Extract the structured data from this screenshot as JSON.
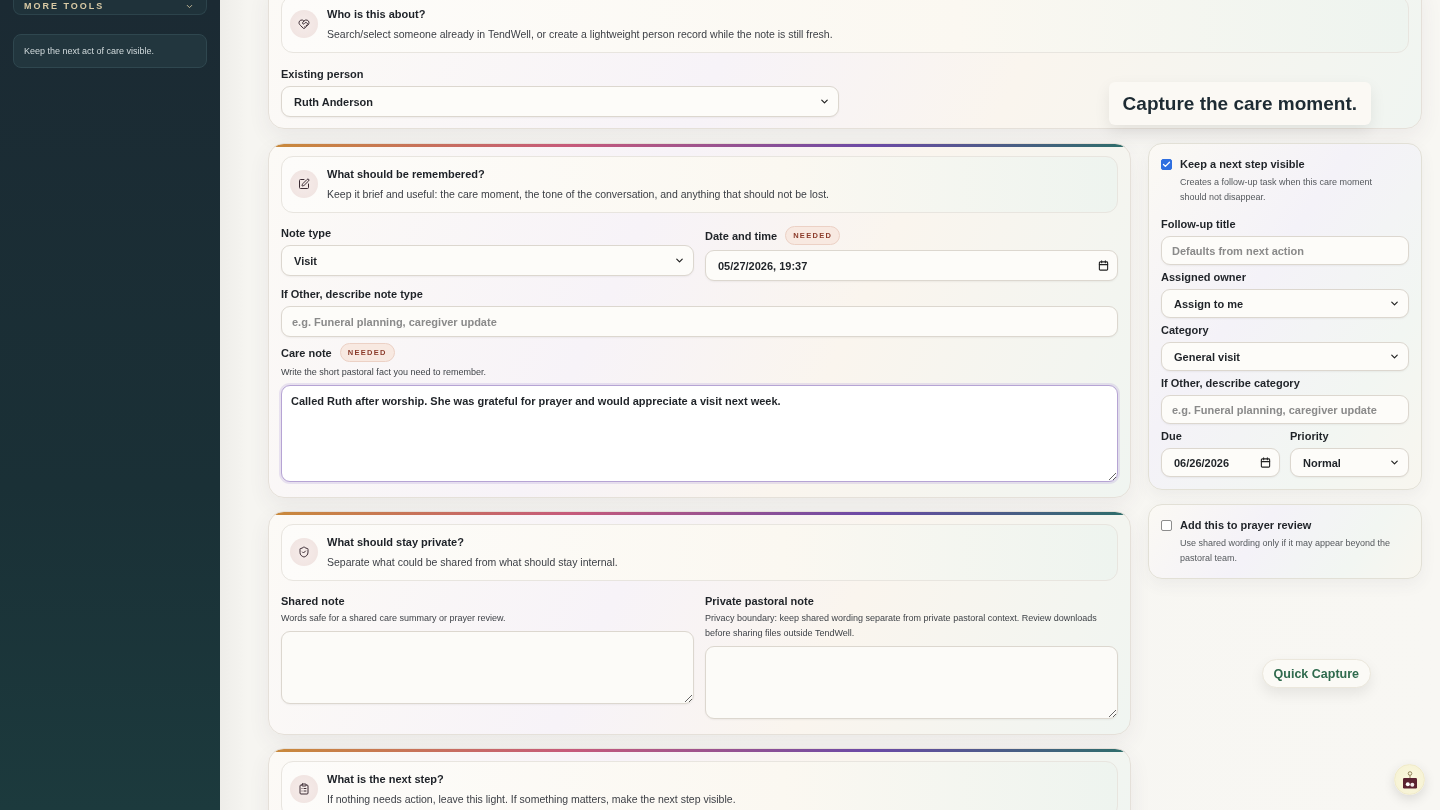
{
  "sidebar": {
    "menu_button": {
      "label": "MORE TOOLS"
    },
    "note": "Keep the next act of care visible."
  },
  "person_section": {
    "kind": "person",
    "title": "Who is this about?",
    "description": "Search/select someone already in TendWell, or create a lightweight person record while the note is still fresh.",
    "field": {
      "kind": "select",
      "label": "Existing person",
      "value": "Ruth Anderson"
    },
    "tagline": "Capture the care moment."
  },
  "sections": [
    {
      "kind": "note",
      "title": "What should be remembered?",
      "description": "Keep it brief and useful: the care moment, the tone of the conversation, and anything that should not be lost.",
      "rows": [
        [
          {
            "kind": "select",
            "label": "Note type",
            "value": "Visit"
          },
          {
            "kind": "datetime",
            "label": "Date and time",
            "badge": "NEEDED",
            "value": "05/27/2026, 19:37"
          }
        ],
        [
          {
            "kind": "text",
            "label": "If Other, describe note type",
            "placeholder": "e.g. Funeral planning, caregiver update"
          }
        ],
        [
          {
            "kind": "textarea",
            "label": "Care note",
            "badge": "NEEDED",
            "hint": "Write the short pastoral fact you need to remember.",
            "value": "Called Ruth after worship. She was grateful for prayer and would appreciate a visit next week.",
            "focused": true
          }
        ]
      ]
    },
    {
      "kind": "privacy",
      "title": "What should stay private?",
      "description": "Separate what could be shared from what should stay internal.",
      "rows": [
        [
          {
            "kind": "textarea",
            "label": "Shared note",
            "hint": "Words safe for a shared care summary or prayer review.",
            "focused": false
          },
          {
            "kind": "textarea",
            "label": "Private pastoral note",
            "hint": "Privacy boundary: keep shared wording separate from private pastoral context. Review downloads before sharing files outside TendWell.",
            "focused": false
          }
        ]
      ]
    },
    {
      "kind": "next_step",
      "title": "What is the next step?",
      "description": "If nothing needs action, leave this light. If something matters, make the next step visible."
    }
  ],
  "follow_up": {
    "checked": true,
    "label": "Keep a next step visible",
    "description": "Creates a follow-up task when this care moment should not disappear.",
    "rows": [
      [
        {
          "kind": "text",
          "label": "Follow-up title",
          "placeholder": "Defaults from next action"
        }
      ],
      [
        {
          "kind": "select",
          "label": "Assigned owner",
          "value": "Assign to me"
        }
      ],
      [
        {
          "kind": "select",
          "label": "Category",
          "value": "General visit"
        }
      ],
      [
        {
          "kind": "text",
          "label": "If Other, describe category",
          "placeholder": "e.g. Funeral planning, caregiver update"
        }
      ],
      [
        {
          "kind": "date",
          "label": "Due",
          "value": "06/26/2026"
        },
        {
          "kind": "select",
          "label": "Priority",
          "value": "Normal"
        }
      ]
    ]
  },
  "prayer_review": {
    "checked": false,
    "label": "Add this to prayer review",
    "description": "Use shared wording only if it may appear beyond the pastoral team."
  },
  "quick_capture": {
    "label": "Quick Capture"
  }
}
